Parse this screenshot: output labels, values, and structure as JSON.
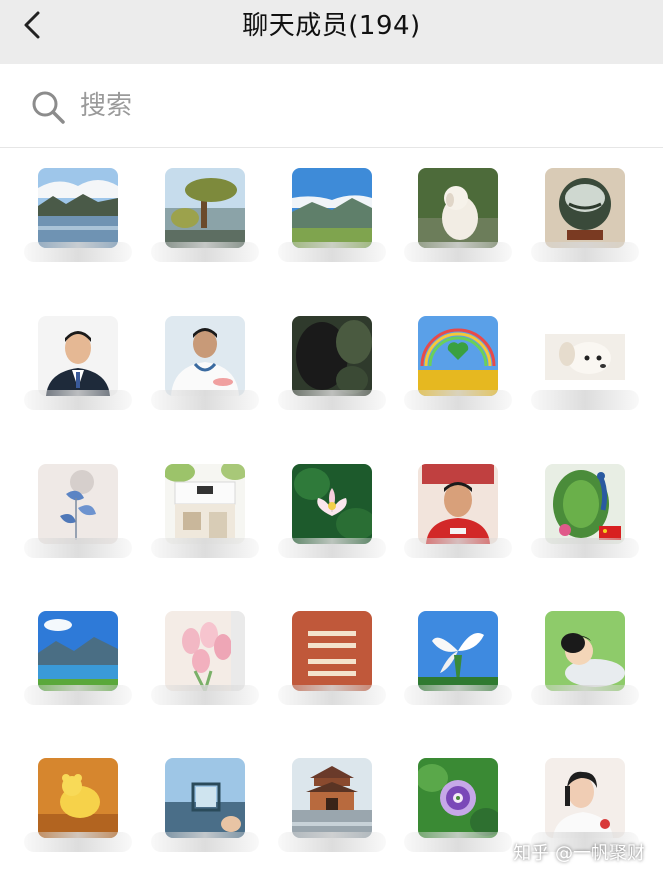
{
  "header": {
    "title": "聊天成员(194)"
  },
  "search": {
    "placeholder": "搜索"
  },
  "members": [
    {
      "name": "",
      "avatar": "lake-mountain"
    },
    {
      "name": "",
      "avatar": "lake-tree"
    },
    {
      "name": "",
      "avatar": "mountain-plain"
    },
    {
      "name": "",
      "avatar": "white-dog"
    },
    {
      "name": "",
      "avatar": "vase"
    },
    {
      "name": "",
      "avatar": "man-suit"
    },
    {
      "name": "",
      "avatar": "doctor"
    },
    {
      "name": "",
      "avatar": "gorilla"
    },
    {
      "name": "",
      "avatar": "rainbow-heart"
    },
    {
      "name": "",
      "avatar": "white-puppy"
    },
    {
      "name": "",
      "avatar": "blue-flowers"
    },
    {
      "name": "",
      "avatar": "shop-front"
    },
    {
      "name": "",
      "avatar": "lotus"
    },
    {
      "name": "",
      "avatar": "boy-red-shirt"
    },
    {
      "name": "",
      "avatar": "peacock"
    },
    {
      "name": "",
      "avatar": "blue-lake"
    },
    {
      "name": "",
      "avatar": "tulips"
    },
    {
      "name": "",
      "avatar": "calligraphy"
    },
    {
      "name": "",
      "avatar": "white-lily"
    },
    {
      "name": "",
      "avatar": "anime-boy"
    },
    {
      "name": "",
      "avatar": "yellow-bear"
    },
    {
      "name": "",
      "avatar": "photo-frame"
    },
    {
      "name": "",
      "avatar": "pavilion"
    },
    {
      "name": "",
      "avatar": "passion-flower"
    },
    {
      "name": "",
      "avatar": "girl"
    }
  ],
  "watermark": "知乎 @一帆聚财"
}
